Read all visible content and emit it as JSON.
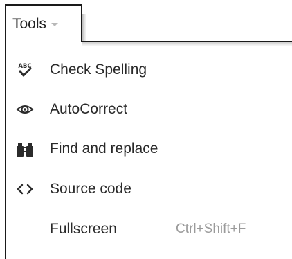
{
  "menu": {
    "title": "Tools",
    "items": [
      {
        "label": "Check Spelling",
        "icon": "spellcheck-icon"
      },
      {
        "label": "AutoCorrect",
        "icon": "eye-icon"
      },
      {
        "label": "Find and replace",
        "icon": "binoculars-icon"
      },
      {
        "label": "Source code",
        "icon": "code-icon"
      },
      {
        "label": "Fullscreen",
        "shortcut": "Ctrl+Shift+F"
      }
    ]
  }
}
